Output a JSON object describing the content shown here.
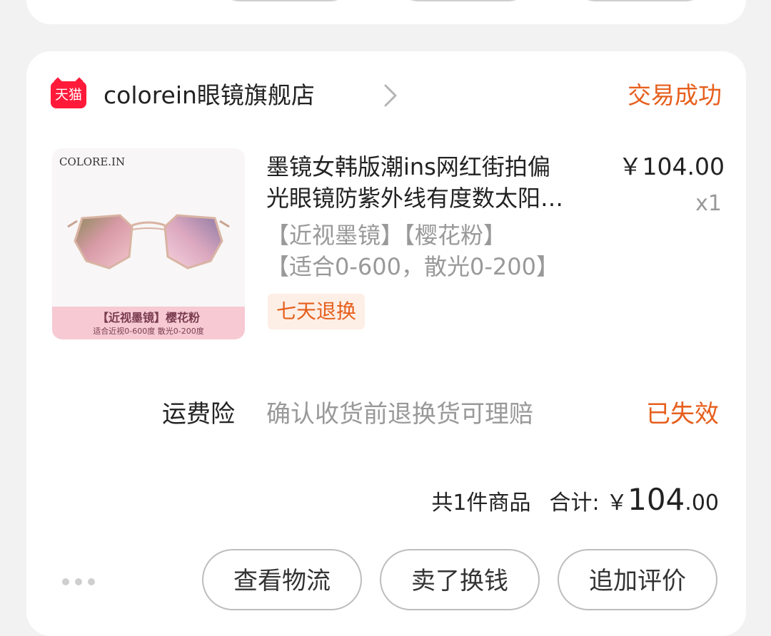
{
  "order": {
    "shop_badge": "天猫",
    "shop_name": "colorein眼镜旗舰店",
    "status": "交易成功",
    "product": {
      "thumb_brand": "COLORE.IN",
      "thumb_band_1": "【近视墨镜】樱花粉",
      "thumb_band_2": "适合近视0-600度  散光0-200度",
      "title_line_1": "墨镜女韩版潮ins网红街拍偏",
      "title_line_2": "光眼镜防紫外线有度数太阳…",
      "spec_line_1": "【近视墨镜】【樱花粉】",
      "spec_line_2": "【适合0-600，散光0-200】",
      "tag": "七天退换",
      "price": "￥104.00",
      "quantity": "x1"
    },
    "insurance": {
      "label": "运费险",
      "desc": "确认收货前退换货可理赔",
      "status": "已失效"
    },
    "summary": {
      "count_text": "共1件商品",
      "total_label": "合计: ￥",
      "total_int": "104",
      "total_dec": ".00"
    },
    "actions": {
      "logistics": "查看物流",
      "sell": "卖了换钱",
      "review": "追加评价"
    }
  },
  "colors": {
    "accent": "#e65f1d",
    "tmall_red": "#ff1a3a",
    "muted": "#999999"
  }
}
